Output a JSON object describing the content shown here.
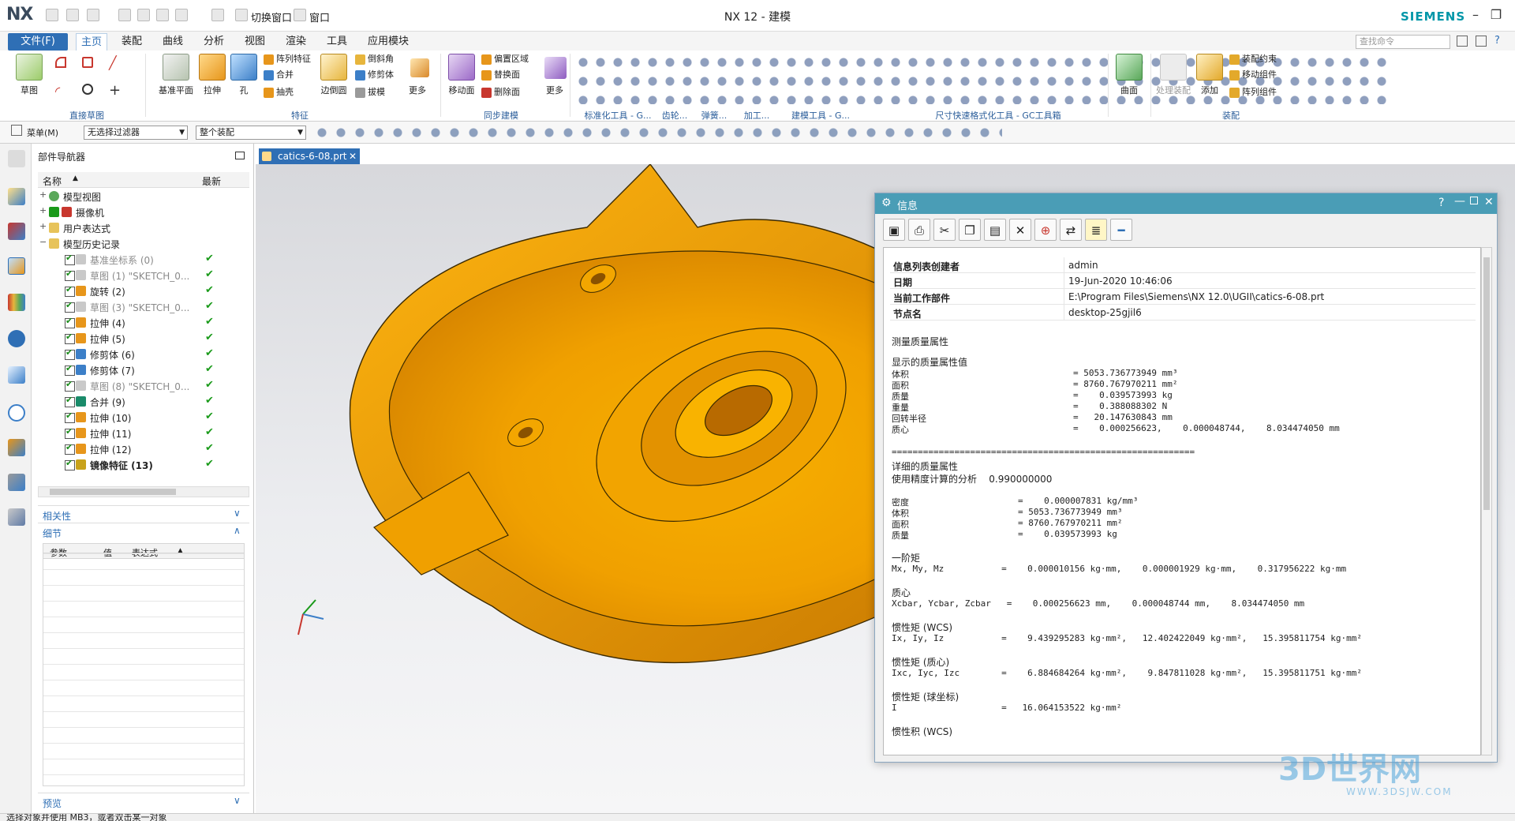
{
  "titlebar": {
    "logo": "NX",
    "switch_window": "切换窗口",
    "window_menu": "窗口",
    "app_title": "NX 12 - 建模",
    "brand": "SIEMENS"
  },
  "menubar": {
    "file": "文件(F)",
    "tabs": [
      "主页",
      "装配",
      "曲线",
      "分析",
      "视图",
      "渲染",
      "工具",
      "应用模块"
    ],
    "active_tab": "主页",
    "search_placeholder": "查找命令"
  },
  "ribbon": {
    "sketch": "草图",
    "direct_sketch": "直接草图",
    "datum_plane": "基准平面",
    "extrude": "拉伸",
    "hole": "孔",
    "pattern_feature": "阵列特征",
    "unite": "合并",
    "shell": "抽壳",
    "edge_blend": "边倒圆",
    "chamfer": "倒斜角",
    "trim_body": "修剪体",
    "draft": "拔模",
    "more": "更多",
    "feature_group": "特征",
    "move_face": "移动面",
    "offset_region": "偏置区域",
    "replace_face": "替换面",
    "delete_face": "删除面",
    "sync_group": "同步建模",
    "more2": "更多",
    "std_tools": "标准化工具 - G...",
    "gear": "齿轮...",
    "spring": "弹簧...",
    "machining": "加工...",
    "modeling_tools": "建模工具 - G...",
    "dim_tools": "尺寸快速格式化工具 - GC工具箱",
    "surface": "曲面",
    "process_assembly": "处理装配",
    "add": "添加",
    "assembly_constraint": "装配约束",
    "move_component": "移动组件",
    "pattern_component": "阵列组件",
    "assembly_group": "装配"
  },
  "selbar": {
    "menu": "菜单(M)",
    "filter": "无选择过滤器",
    "scope": "整个装配"
  },
  "navigator": {
    "title": "部件导航器",
    "col_name": "名称",
    "col_latest": "最新",
    "tree": [
      {
        "label": "模型视图",
        "style": "normal"
      },
      {
        "label": "摄像机",
        "style": "normal"
      },
      {
        "label": "用户表达式",
        "style": "normal"
      },
      {
        "label": "模型历史记录",
        "style": "normal"
      },
      {
        "label": "基准坐标系 (0)",
        "style": "grey"
      },
      {
        "label": "草图 (1) \"SKETCH_0...",
        "style": "grey"
      },
      {
        "label": "旋转 (2)",
        "style": "normal"
      },
      {
        "label": "草图 (3) \"SKETCH_0...",
        "style": "grey"
      },
      {
        "label": "拉伸 (4)",
        "style": "normal"
      },
      {
        "label": "拉伸 (5)",
        "style": "normal"
      },
      {
        "label": "修剪体 (6)",
        "style": "normal"
      },
      {
        "label": "修剪体 (7)",
        "style": "normal"
      },
      {
        "label": "草图 (8) \"SKETCH_0...",
        "style": "grey"
      },
      {
        "label": "合并 (9)",
        "style": "normal"
      },
      {
        "label": "拉伸 (10)",
        "style": "normal"
      },
      {
        "label": "拉伸 (11)",
        "style": "normal"
      },
      {
        "label": "拉伸 (12)",
        "style": "normal"
      },
      {
        "label": "镜像特征 (13)",
        "style": "bold"
      }
    ],
    "dependencies": "相关性",
    "details": "细节",
    "details_cols": [
      "参数",
      "值",
      "表达式"
    ],
    "preview": "预览"
  },
  "document": {
    "tab": "catics-6-08.prt"
  },
  "info": {
    "title": "信息",
    "header": [
      {
        "k": "信息列表创建者",
        "v": "admin"
      },
      {
        "k": "日期",
        "v": "19-Jun-2020 10:46:06"
      },
      {
        "k": "当前工作部件",
        "v": "E:\\Program Files\\Siemens\\NX 12.0\\UGII\\catics-6-08.prt"
      },
      {
        "k": "节点名",
        "v": "desktop-25gjil6"
      }
    ],
    "measure_title": "测量质量属性",
    "shown_values": "显示的质量属性值",
    "l_volume": "体积",
    "v_volume": "= 5053.736773949 mm³",
    "l_area": "面积",
    "v_area": "= 8760.767970211 mm²",
    "l_mass": "质量",
    "v_mass": "=    0.039573993 kg",
    "l_weight": "重量",
    "v_weight": "=    0.388088302 N",
    "l_radius": "回转半径",
    "v_radius": "=   20.147630843 mm",
    "l_centroid": "质心",
    "v_centroid": "=    0.000256623,    0.000048744,    8.034474050 mm",
    "separator": "==========================================================",
    "detail_title": "详细的质量属性",
    "accuracy": "使用精度计算的分析    0.990000000",
    "l_density": "密度",
    "v_density": "=    0.000007831 kg/mm³",
    "l_volume2": "体积",
    "v_volume2": "= 5053.736773949 mm³",
    "l_area2": "面积",
    "v_area2": "= 8760.767970211 mm²",
    "l_mass2": "质量",
    "v_mass2": "=    0.039573993 kg",
    "first_moment": "一阶矩",
    "first_moment_line": "Mx, My, Mz           =    0.000010156 kg·mm,    0.000001929 kg·mm,    0.317956222 kg·mm",
    "centroid_title": "质心",
    "centroid_line": "Xcbar, Ycbar, Zcbar   =    0.000256623 mm,    0.000048744 mm,    8.034474050 mm",
    "inertia_wcs": "惯性矩 (WCS)",
    "inertia_wcs_line": "Ix, Iy, Iz           =    9.439295283 kg·mm²,   12.402422049 kg·mm²,   15.395811754 kg·mm²",
    "inertia_centroid": "惯性矩 (质心)",
    "inertia_centroid_line": "Ixc, Iyc, Izc        =    6.884684264 kg·mm²,    9.847811028 kg·mm²,   15.395811751 kg·mm²",
    "inertia_spherical": "惯性矩 (球坐标)",
    "inertia_spherical_line": "I                    =   16.064153522 kg·mm²",
    "product_inertia": "惯性积 (WCS)"
  },
  "status": "选择对象并使用 MB3，或者双击某一对象",
  "watermark": {
    "main": "3D世界网",
    "sub": "WWW.3DSJW.COM"
  }
}
